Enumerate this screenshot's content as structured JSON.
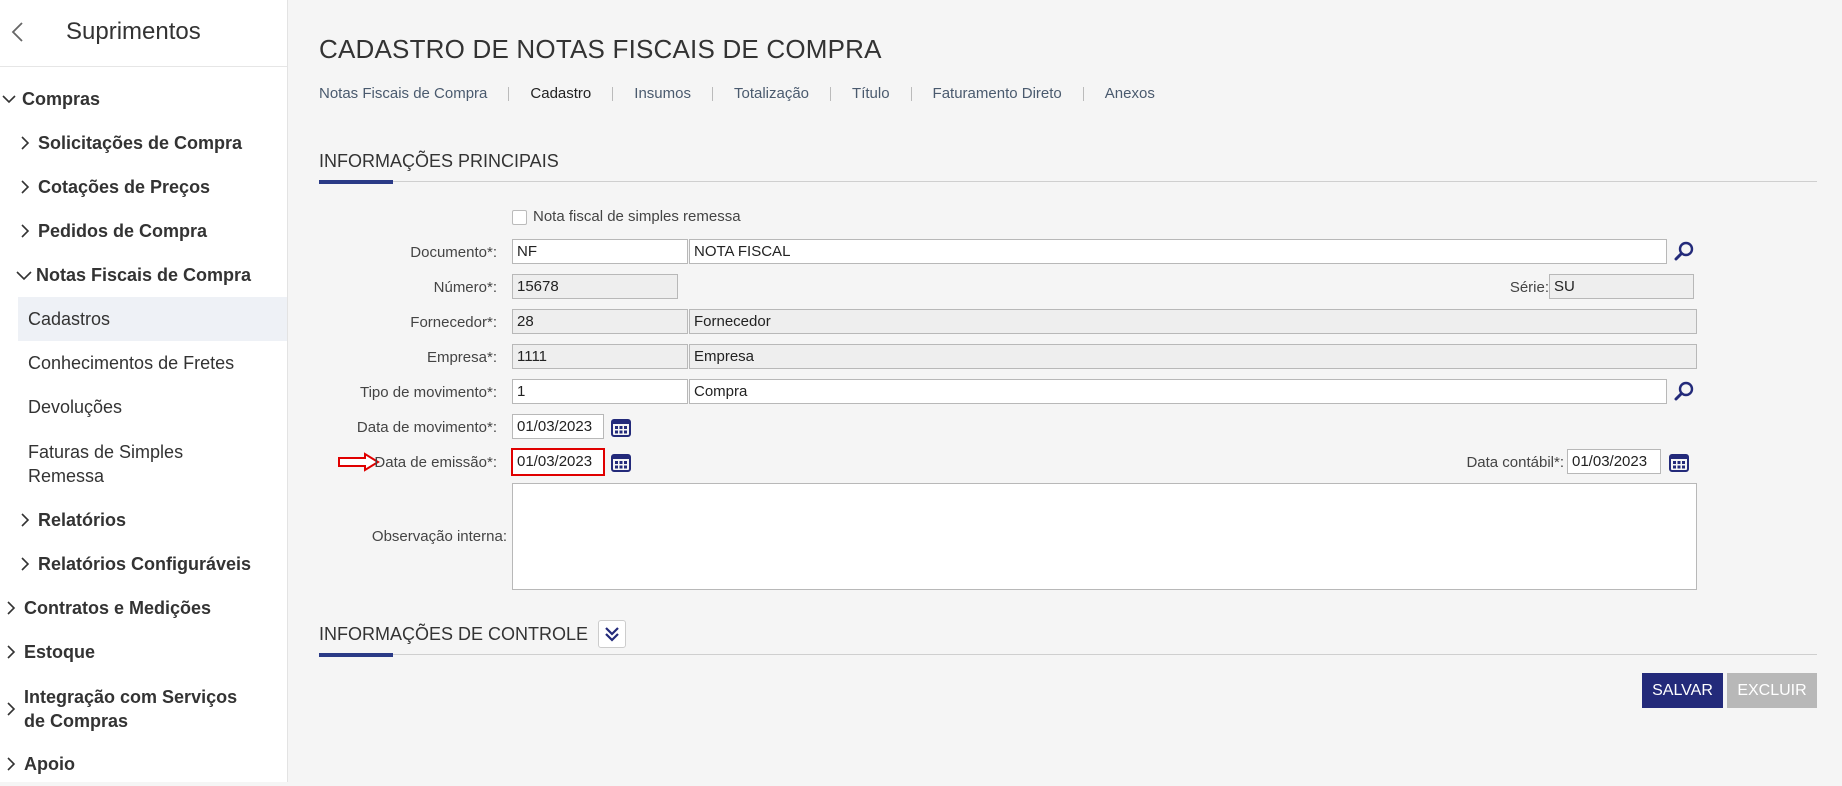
{
  "sidebar": {
    "title": "Suprimentos",
    "items": [
      {
        "label": "Compras"
      },
      {
        "label": "Solicitações de Compra"
      },
      {
        "label": "Cotações de Preços"
      },
      {
        "label": "Pedidos de Compra"
      },
      {
        "label": "Notas Fiscais de Compra"
      },
      {
        "label": "Cadastros"
      },
      {
        "label": "Conhecimentos de Fretes"
      },
      {
        "label": "Devoluções"
      },
      {
        "label": "Faturas de Simples Remessa"
      },
      {
        "label": "Relatórios"
      },
      {
        "label": "Relatórios Configuráveis"
      },
      {
        "label": "Contratos e Medições"
      },
      {
        "label": "Estoque"
      },
      {
        "label": "Integração com Serviços de Compras"
      },
      {
        "label": "Apoio"
      }
    ]
  },
  "page": {
    "title": "CADASTRO DE NOTAS FISCAIS DE COMPRA",
    "tabs": [
      {
        "label": "Notas Fiscais de Compra"
      },
      {
        "label": "Cadastro"
      },
      {
        "label": "Insumos"
      },
      {
        "label": "Totalização"
      },
      {
        "label": "Título"
      },
      {
        "label": "Faturamento Direto"
      },
      {
        "label": "Anexos"
      }
    ]
  },
  "main_section": {
    "title": "INFORMAÇÕES PRINCIPAIS",
    "simples_remessa_label": "Nota fiscal de simples remessa",
    "documento": {
      "label": "Documento*:",
      "code": "NF",
      "desc": "NOTA FISCAL"
    },
    "numero": {
      "label": "Número*:",
      "value": "15678"
    },
    "serie": {
      "label": "Série:",
      "value": "SU"
    },
    "fornecedor": {
      "label": "Fornecedor*:",
      "code": "28",
      "desc": "Fornecedor"
    },
    "empresa": {
      "label": "Empresa*:",
      "code": "1111",
      "desc": "Empresa"
    },
    "tipo_movimento": {
      "label": "Tipo de movimento*:",
      "code": "1",
      "desc": "Compra"
    },
    "data_movimento": {
      "label": "Data de movimento*:",
      "value": "01/03/2023"
    },
    "data_emissao": {
      "label": "Data de emissão*:",
      "value": "01/03/2023"
    },
    "data_contabil": {
      "label": "Data contábil*:",
      "value": "01/03/2023"
    },
    "observacao": {
      "label": "Observação interna:",
      "value": ""
    }
  },
  "control_section": {
    "title": "INFORMAÇÕES DE CONTROLE"
  },
  "actions": {
    "save": "SALVAR",
    "delete": "EXCLUIR"
  },
  "colors": {
    "primary": "#232a7a",
    "highlight": "#e00000",
    "disabled": "#b8b8b8"
  }
}
